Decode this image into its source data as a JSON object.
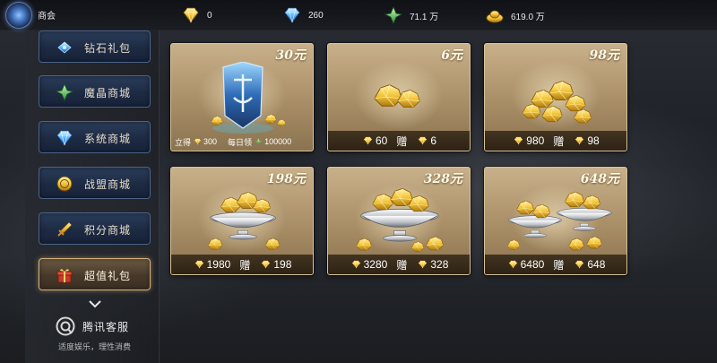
{
  "topbar": {
    "title": "商会",
    "currencies": [
      {
        "icon": "gold-diamond-icon",
        "value": "0"
      },
      {
        "icon": "blue-diamond-icon",
        "value": "260"
      },
      {
        "icon": "green-crystal-icon",
        "value": "71.1 万"
      },
      {
        "icon": "gold-ingot-icon",
        "value": "619.0 万"
      }
    ]
  },
  "sidebar": {
    "items": [
      {
        "label": "钻石礼包",
        "icon": "blue-gem-icon",
        "active": false
      },
      {
        "label": "魔晶商城",
        "icon": "green-crystal-icon",
        "active": false
      },
      {
        "label": "系统商城",
        "icon": "blue-diamond-icon",
        "active": false
      },
      {
        "label": "战盟商城",
        "icon": "guild-coin-icon",
        "active": false
      },
      {
        "label": "积分商城",
        "icon": "sword-icon",
        "active": false
      },
      {
        "label": "超值礼包",
        "icon": "gift-box-icon",
        "active": true
      }
    ],
    "support_title": "腾讯客服",
    "support_subtitle": "适度娱乐，理性消费"
  },
  "packs": [
    {
      "price": "30元",
      "instant_label": "立得",
      "instant": "300",
      "daily_label": "每日领",
      "daily": "100000"
    },
    {
      "price": "6元",
      "amount": "60",
      "gift_label": "赠",
      "bonus": "6"
    },
    {
      "price": "98元",
      "amount": "980",
      "gift_label": "赠",
      "bonus": "98"
    },
    {
      "price": "198元",
      "amount": "1980",
      "gift_label": "赠",
      "bonus": "198"
    },
    {
      "price": "328元",
      "amount": "3280",
      "gift_label": "赠",
      "bonus": "328"
    },
    {
      "price": "648元",
      "amount": "6480",
      "gift_label": "赠",
      "bonus": "648"
    }
  ],
  "colors": {
    "active_border": "#d4b37a",
    "nav_border": "#4b6389",
    "card_gold": "#c8b08a"
  }
}
